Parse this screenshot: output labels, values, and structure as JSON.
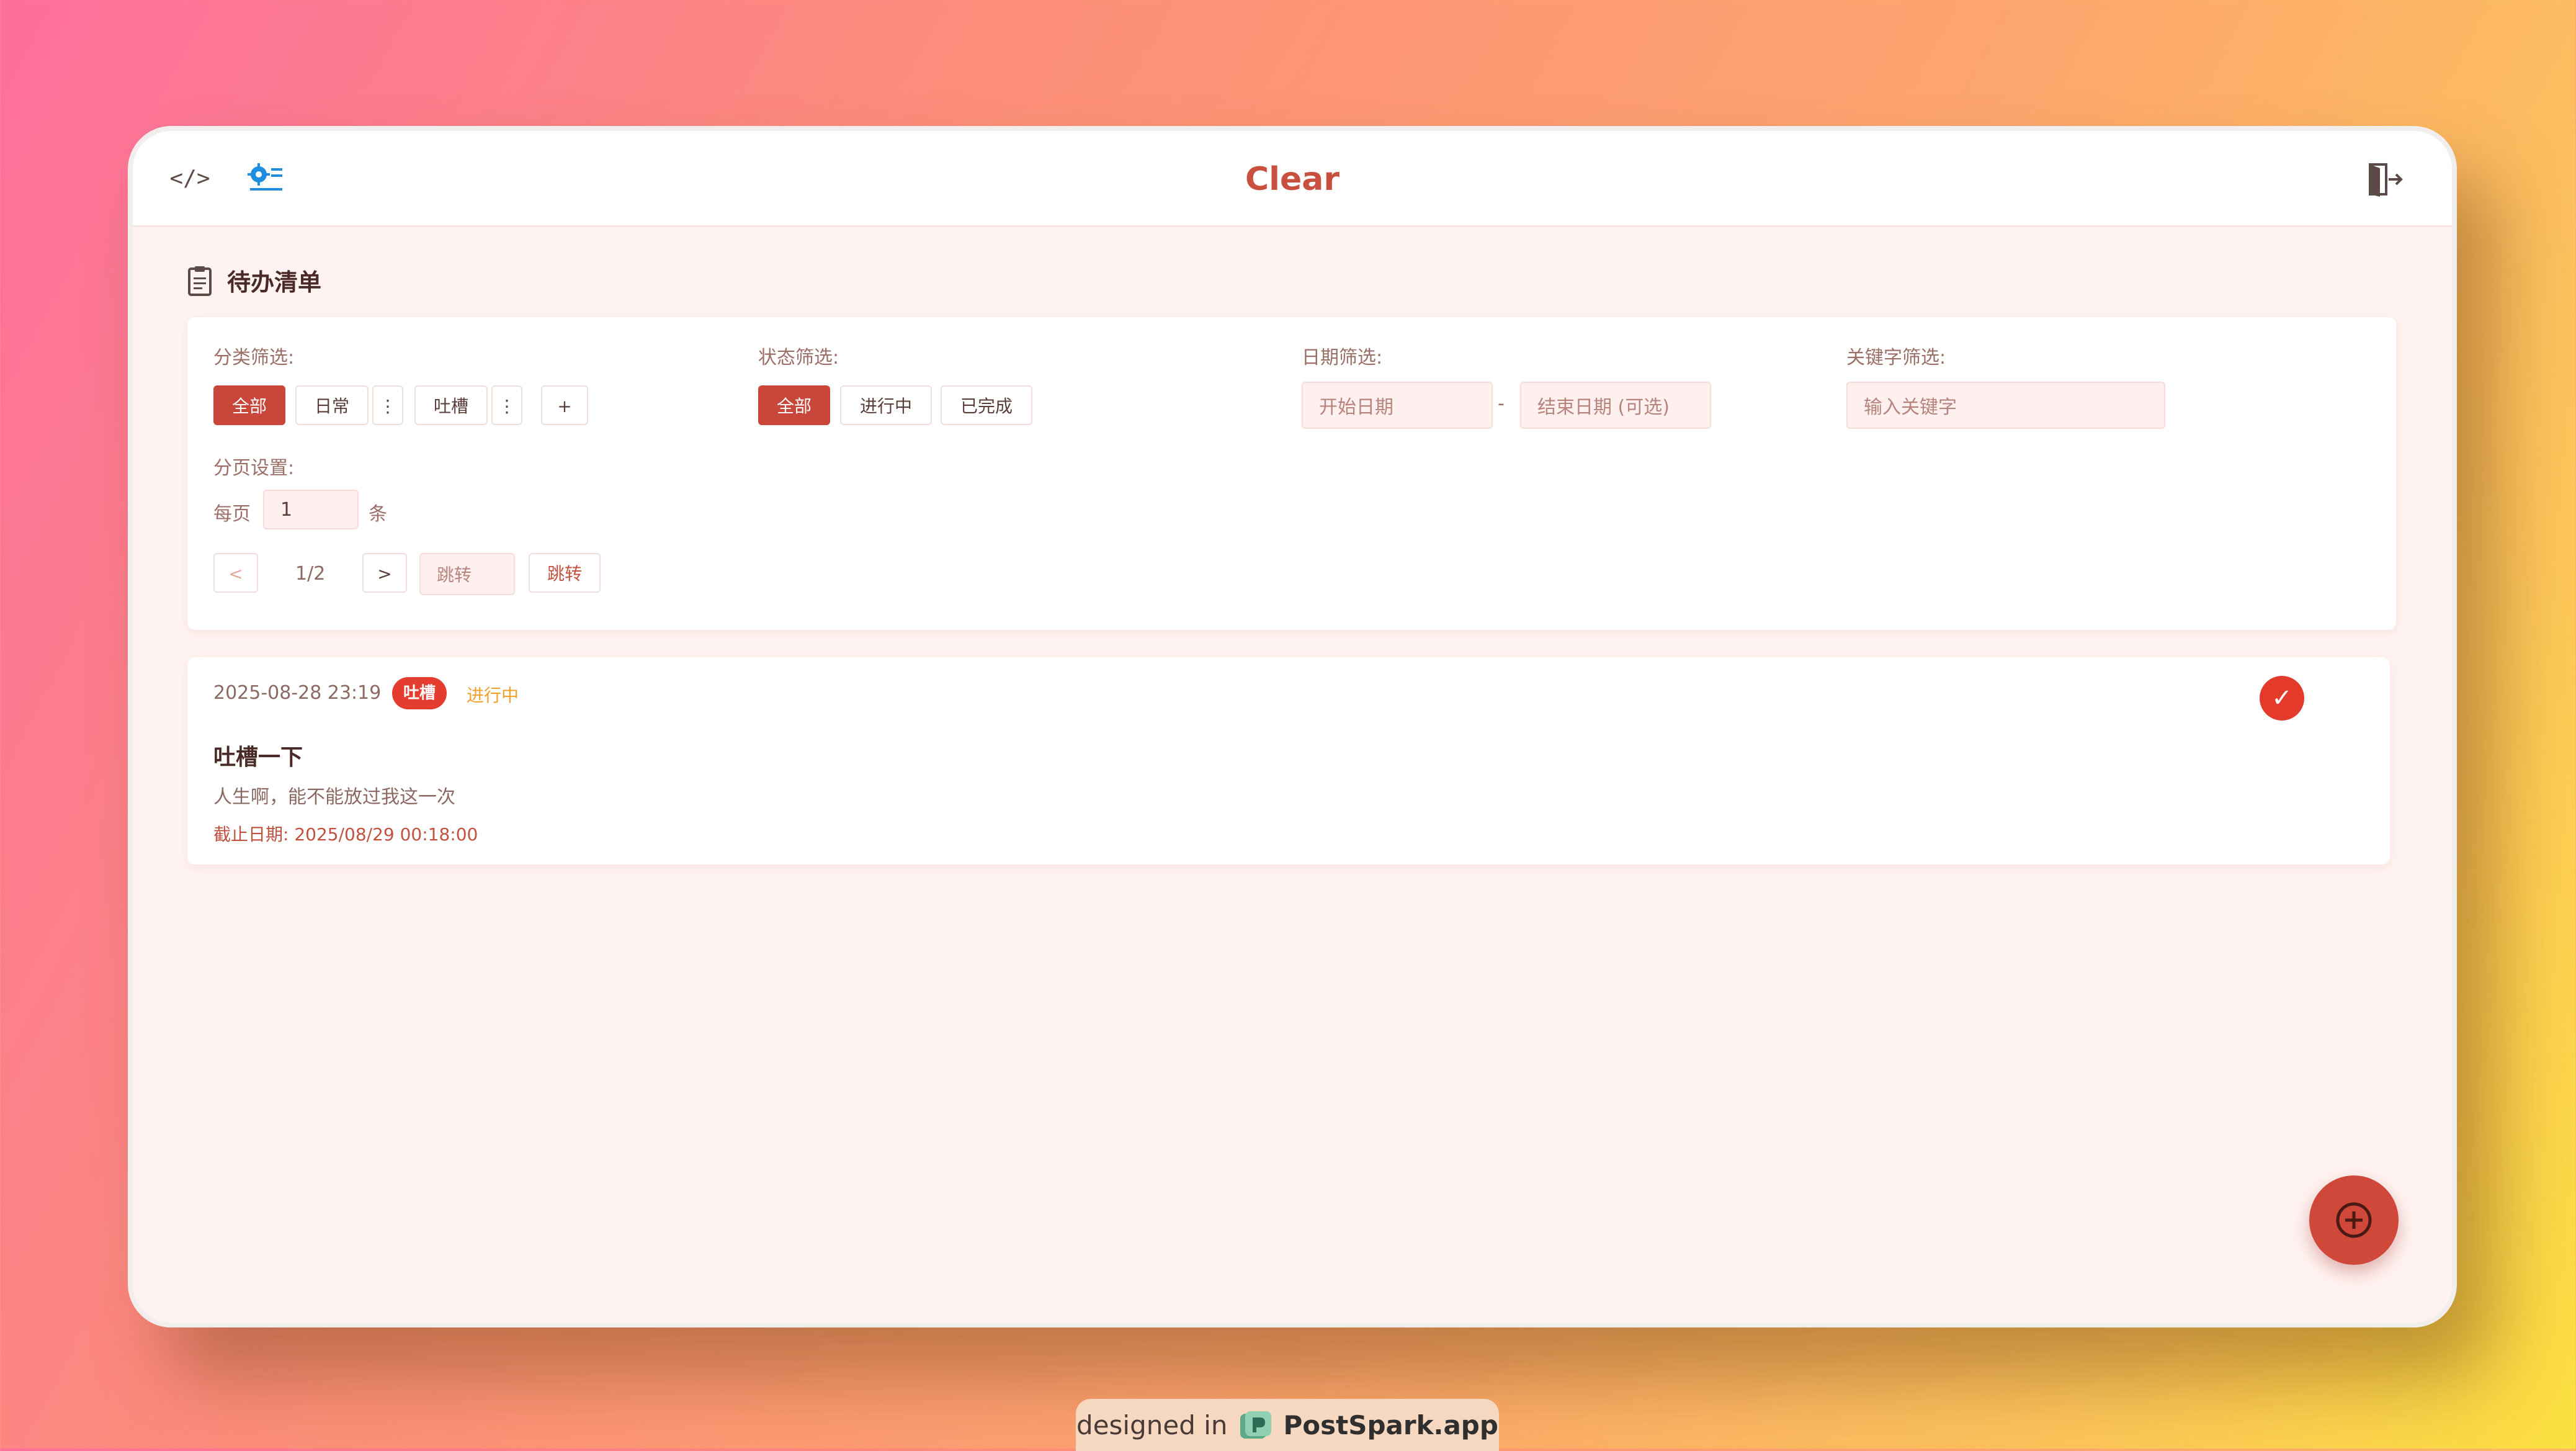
{
  "app": {
    "title": "Clear"
  },
  "page": {
    "title": "待办清单"
  },
  "filters": {
    "category": {
      "label": "分类筛选:",
      "chips": [
        "全部",
        "日常",
        "吐槽"
      ],
      "more": "⋮",
      "add": "+"
    },
    "status": {
      "label": "状态筛选:",
      "chips": [
        "全部",
        "进行中",
        "已完成"
      ]
    },
    "date": {
      "label": "日期筛选:",
      "start_placeholder": "开始日期",
      "separator": "-",
      "end_placeholder": "结束日期 (可选)"
    },
    "keyword": {
      "label": "关键字筛选:",
      "placeholder": "输入关键字"
    },
    "pagination": {
      "label": "分页设置:",
      "per_page_prefix": "每页",
      "per_page_value": "1",
      "per_page_suffix": "条",
      "prev": "<",
      "page": "1/2",
      "next": ">",
      "jump_placeholder": "跳转",
      "jump_button": "跳转"
    }
  },
  "tasks": [
    {
      "date": "2025-08-28 23:19",
      "tag": "吐槽",
      "status": "进行中",
      "title": "吐槽一下",
      "description": "人生啊，能不能放过我这一次",
      "deadline": "截止日期: 2025/08/29 00:18:00",
      "done_glyph": "✓"
    }
  ],
  "watermark": {
    "prefix": "designed in",
    "brand": "PostSpark.app"
  },
  "colors": {
    "accent": "#c8473a",
    "tag": "#e43d2f",
    "status_pending": "#f0a02c",
    "settings_icon": "#1f8ee0"
  },
  "icons": [
    "code-icon",
    "settings-list-icon",
    "logout-icon",
    "clipboard-icon",
    "add-circle-icon",
    "check-icon",
    "postspark-logo-icon"
  ]
}
